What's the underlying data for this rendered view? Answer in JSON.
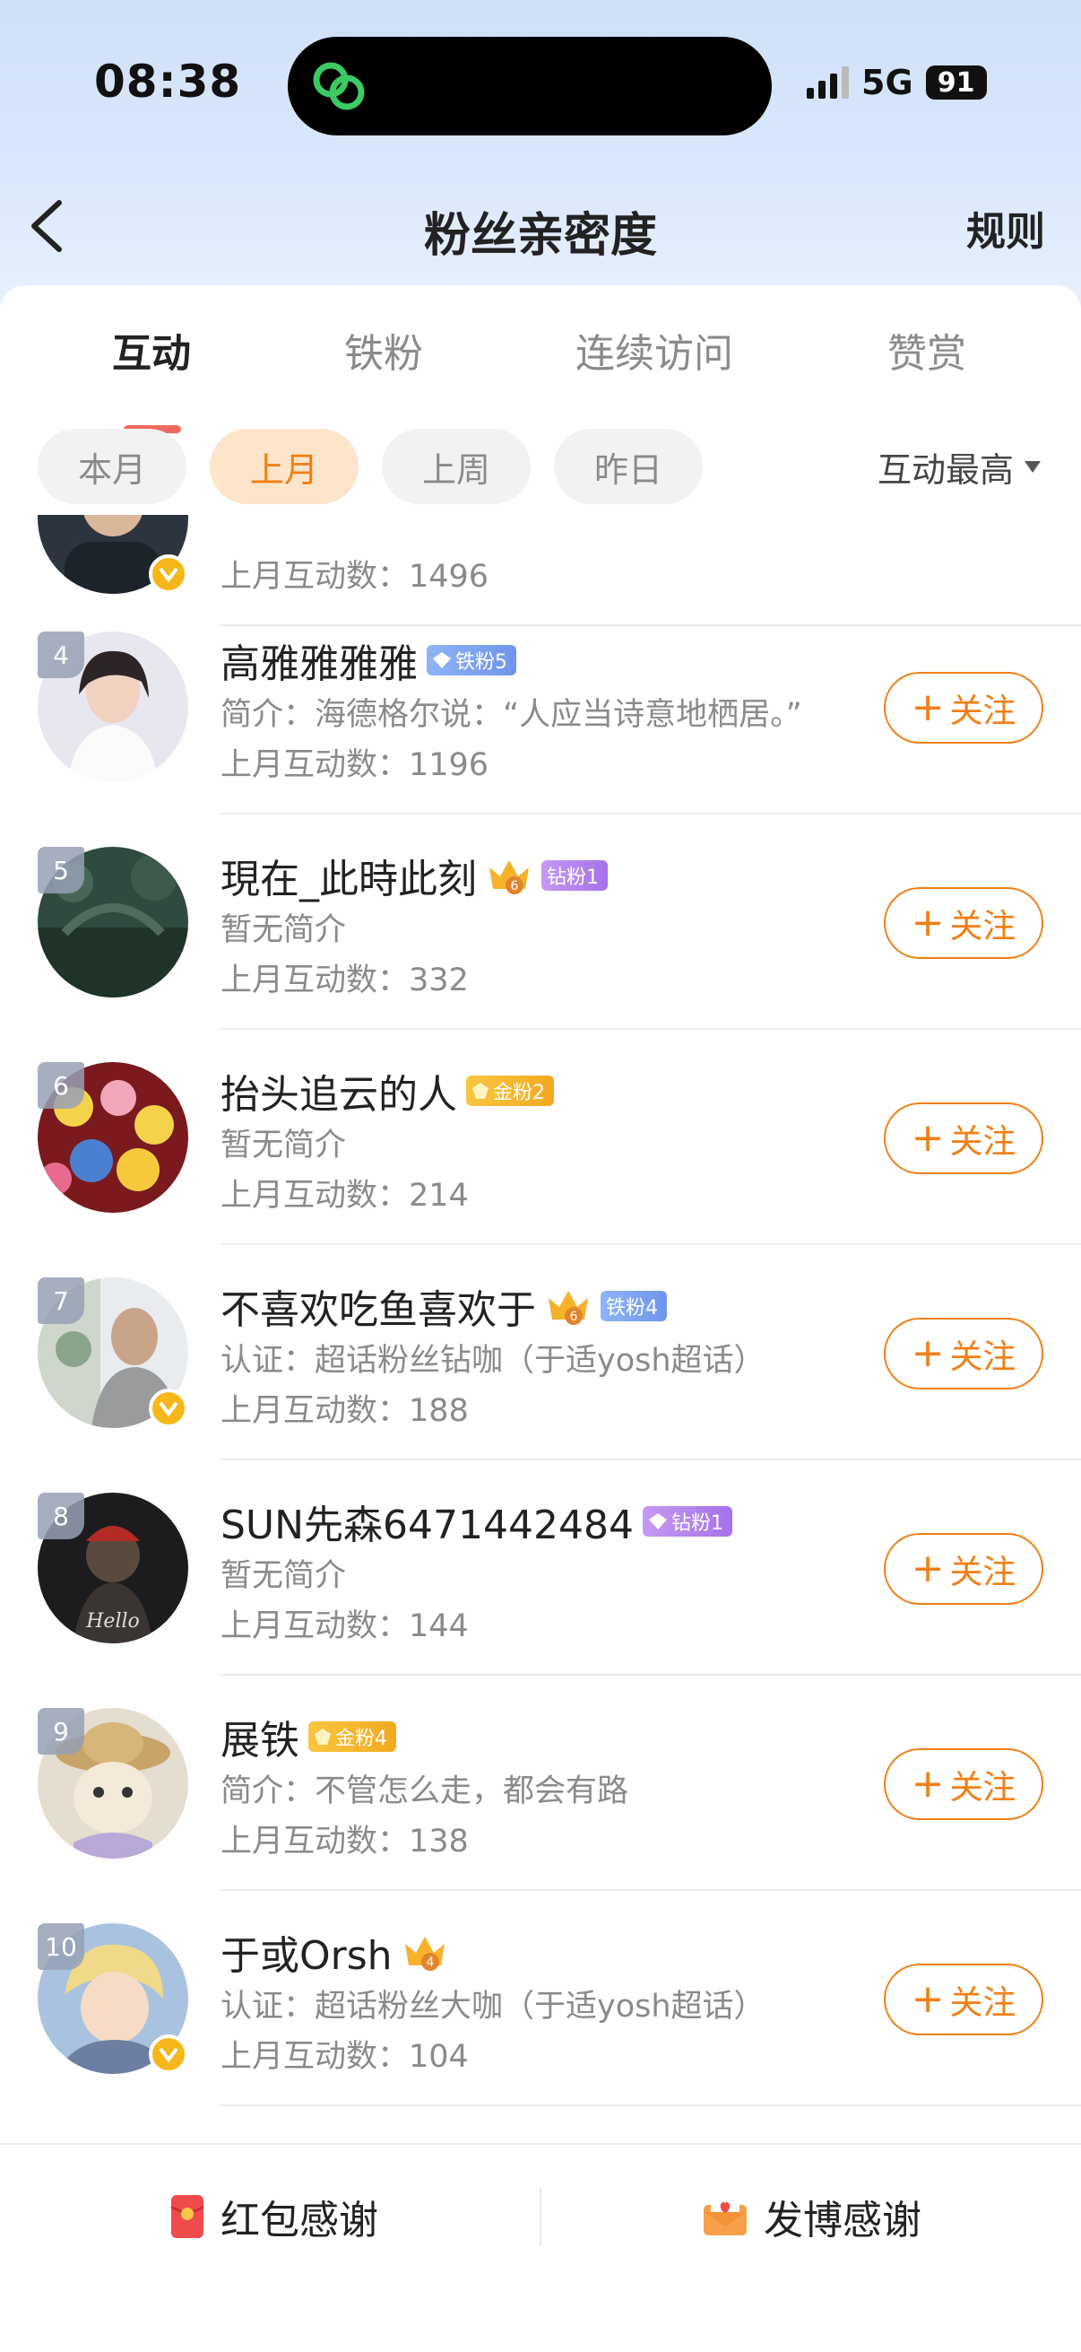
{
  "status_bar": {
    "time": "08:38",
    "network": "5G",
    "battery": "91"
  },
  "nav": {
    "title": "粉丝亲密度",
    "rule_label": "规则"
  },
  "tabs": [
    {
      "label": "互动",
      "active": true
    },
    {
      "label": "铁粉",
      "active": false
    },
    {
      "label": "连续访问",
      "active": false
    },
    {
      "label": "赞赏",
      "active": false
    }
  ],
  "filters": [
    {
      "label": "本月",
      "active": false
    },
    {
      "label": "上月",
      "active": true
    },
    {
      "label": "上周",
      "active": false
    },
    {
      "label": "昨日",
      "active": false
    }
  ],
  "sort_label": "互动最高",
  "partial_row": {
    "count": "上月互动数：1496"
  },
  "fans": [
    {
      "rank": "4",
      "name": "高雅雅雅雅",
      "badge_type": "iron",
      "badge": "铁粉5",
      "crown": false,
      "verified": false,
      "intro": "简介：海德格尔说：“人应当诗意地栖居。”",
      "count": "上月互动数：1196",
      "follow": "关注"
    },
    {
      "rank": "5",
      "name": "現在_此時此刻",
      "badge_type": "diamond",
      "badge": "钻粉1",
      "crown": true,
      "crown_level": "6",
      "verified": false,
      "intro": "暂无简介",
      "count": "上月互动数：332",
      "follow": "关注"
    },
    {
      "rank": "6",
      "name": "抬头追云的人",
      "badge_type": "gold",
      "badge": "金粉2",
      "crown": false,
      "verified": false,
      "intro": "暂无简介",
      "count": "上月互动数：214",
      "follow": "关注"
    },
    {
      "rank": "7",
      "name": "不喜欢吃鱼喜欢于",
      "badge_type": "iron",
      "badge": "铁粉4",
      "crown": true,
      "crown_level": "6",
      "verified": true,
      "intro": "认证：超话粉丝钻咖（于适yosh超话）",
      "count": "上月互动数：188",
      "follow": "关注"
    },
    {
      "rank": "8",
      "name": "SUN先森6471442484",
      "badge_type": "diamond",
      "badge": "钻粉1",
      "crown": false,
      "verified": false,
      "intro": "暂无简介",
      "count": "上月互动数：144",
      "follow": "关注"
    },
    {
      "rank": "9",
      "name": "展铁",
      "badge_type": "gold",
      "badge": "金粉4",
      "crown": false,
      "verified": false,
      "intro": "简介：不管怎么走，都会有路",
      "count": "上月互动数：138",
      "follow": "关注"
    },
    {
      "rank": "10",
      "name": "于或Orsh",
      "badge_type": "",
      "badge": "",
      "crown": true,
      "crown_level": "4",
      "verified": true,
      "intro": "认证：超话粉丝大咖（于适yosh超话）",
      "count": "上月互动数：104",
      "follow": "关注"
    }
  ],
  "bottom": {
    "left_label": "红包感谢",
    "right_label": "发博感谢"
  },
  "colors": {
    "accent": "#f07f14",
    "tab_indicator": "#f06b5f",
    "chip_active_bg": "#fde5cb"
  }
}
